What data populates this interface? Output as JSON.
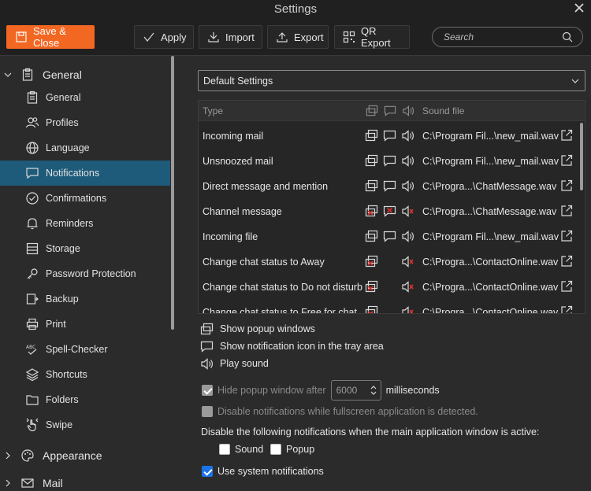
{
  "window": {
    "title": "Settings",
    "close_icon": "close-icon"
  },
  "toolbar": {
    "save_close": "Save & Close",
    "apply": "Apply",
    "import": "Import",
    "export": "Export",
    "qr_export": "QR Export",
    "search_placeholder": "Search",
    "accent_color": "#f26722"
  },
  "sidebar": {
    "general_group": "General",
    "items": [
      {
        "label": "General",
        "icon": "clipboard-icon"
      },
      {
        "label": "Profiles",
        "icon": "profiles-icon"
      },
      {
        "label": "Language",
        "icon": "globe-icon"
      },
      {
        "label": "Notifications",
        "icon": "chat-icon",
        "active": true
      },
      {
        "label": "Confirmations",
        "icon": "check-circle-icon"
      },
      {
        "label": "Reminders",
        "icon": "bell-icon"
      },
      {
        "label": "Storage",
        "icon": "storage-icon"
      },
      {
        "label": "Password Protection",
        "icon": "key-icon"
      },
      {
        "label": "Backup",
        "icon": "backup-icon"
      },
      {
        "label": "Print",
        "icon": "printer-icon"
      },
      {
        "label": "Spell-Checker",
        "icon": "spellcheck-icon"
      },
      {
        "label": "Shortcuts",
        "icon": "layers-icon"
      },
      {
        "label": "Folders",
        "icon": "folder-icon"
      },
      {
        "label": "Swipe",
        "icon": "hand-icon"
      }
    ],
    "appearance_group": "Appearance",
    "mail_group": "Mail",
    "active_color": "#1e5a7a"
  },
  "main": {
    "profile_select": "Default Settings",
    "table": {
      "col_type": "Type",
      "col_sound": "Sound file",
      "rows": [
        {
          "type": "Incoming mail",
          "sound": "C:\\Program Fil...\\new_mail.wav"
        },
        {
          "type": "Unsnoozed mail",
          "sound": "C:\\Program Fil...\\new_mail.wav"
        },
        {
          "type": "Direct message and mention",
          "sound": "C:\\Progra...\\ChatMessage.wav"
        },
        {
          "type": "Channel message",
          "sound": "C:\\Progra...\\ChatMessage.wav"
        },
        {
          "type": "Incoming file",
          "sound": "C:\\Program Fil...\\new_mail.wav"
        },
        {
          "type": "Change chat status to Away",
          "sound": "C:\\Progra...\\ContactOnline.wav"
        },
        {
          "type": "Change chat status to Do not disturb",
          "sound": "C:\\Progra...\\ContactOnline.wav"
        },
        {
          "type": "Change chat status to Free for chat",
          "sound": "C:\\Progra...\\ContactOnline.wav"
        }
      ]
    },
    "legend": {
      "popup": "Show popup windows",
      "tray": "Show notification icon in the tray area",
      "sound": "Play sound"
    },
    "hide_popup_label": "Hide popup window after",
    "hide_popup_value": "6000",
    "milliseconds": "milliseconds",
    "fullscreen_label": "Disable notifications while fullscreen application is detected.",
    "disable_active_label": "Disable the following notifications when the main application window is active:",
    "sound_cb": "Sound",
    "popup_cb": "Popup",
    "system_notif": "Use system notifications"
  }
}
